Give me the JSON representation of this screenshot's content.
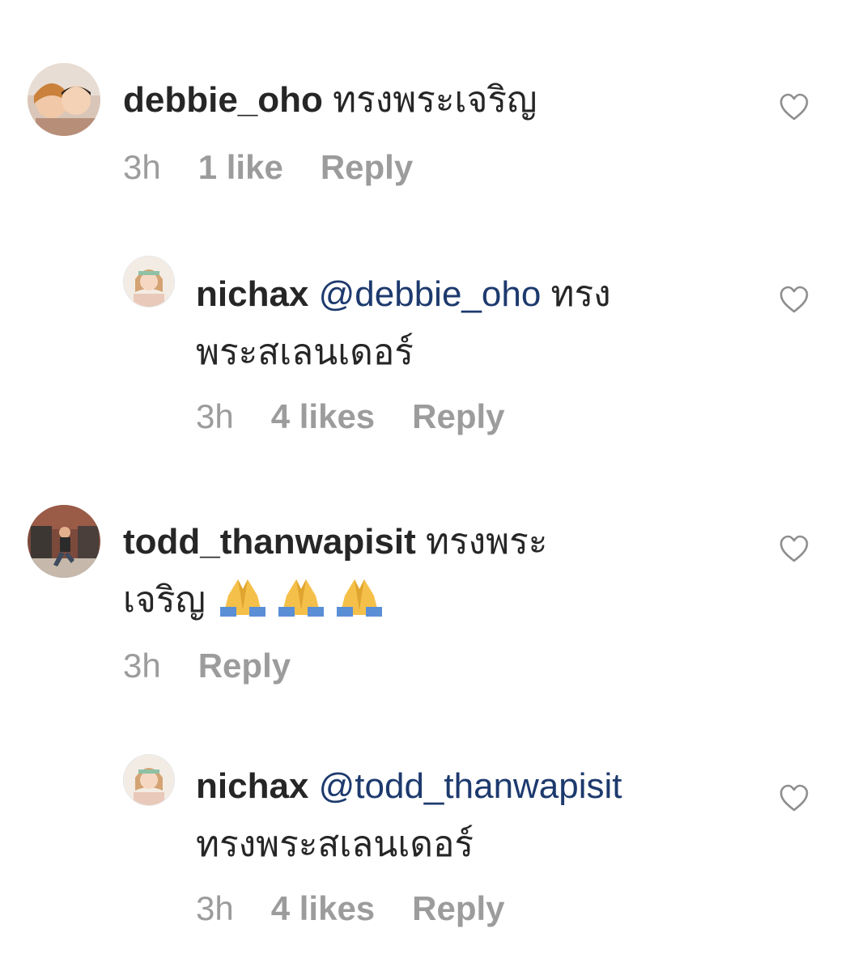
{
  "comments": [
    {
      "username": "debbie_oho",
      "mention": "",
      "text": "ทรงพระเจริญ",
      "time": "3h",
      "likes": "1 like",
      "reply": "Reply"
    },
    {
      "username": "nichax",
      "mention": "@debbie_oho",
      "text_line1": "ทรง",
      "text_line2": "พระสเลนเดอร์",
      "time": "3h",
      "likes": "4 likes",
      "reply": "Reply"
    },
    {
      "username": "todd_thanwapisit",
      "mention": "",
      "text_line1": "ทรงพระ",
      "text_line2": "เจริญ",
      "emoji": "folded-hands x3",
      "time": "3h",
      "reply": "Reply"
    },
    {
      "username": "nichax",
      "mention": "@todd_thanwapisit",
      "text_line2": "ทรงพระสเลนเดอร์",
      "time": "3h",
      "likes": "4 likes",
      "reply": "Reply"
    }
  ],
  "icons": {
    "like": "heart-outline-icon",
    "emoji": "folded-hands-emoji"
  },
  "colors": {
    "text": "#262626",
    "muted": "#9c9c9c",
    "mention": "#1d3a6e",
    "heart_stroke": "#8e8e8e"
  }
}
